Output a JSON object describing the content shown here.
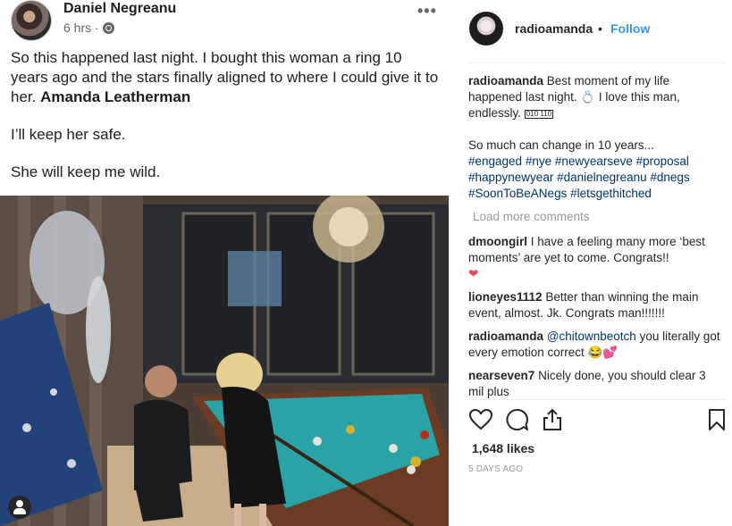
{
  "facebook": {
    "author": "Daniel Negreanu",
    "time": "6 hrs ·",
    "more": "•••",
    "paragraph1_text": "So this happened last night. I bought this woman a ring 10 years ago and the stars finally aligned to where I could give it to her.",
    "paragraph1_mention": "Amanda Leatherman",
    "paragraph2": "I’ll keep her safe.",
    "paragraph3": "She will keep me wild."
  },
  "instagram": {
    "handle": "radioamanda",
    "dot": "•",
    "follow": "Follow",
    "caption_user": "radioamanda",
    "caption_text": "Best moment of my life happened last night. 💍 I love this man, endlessly.",
    "caption_glyph": "010 110",
    "caption_line2": "So much can change in 10 years...",
    "hashtags": "#engaged #nye #newyearseve #proposal #happynewyear #danielnegreanu #dnegs #SoonToBeANegs #letsgethitched",
    "load_more": "Load more comments",
    "comments": [
      {
        "user": "dmoongirl",
        "text": "I have a feeling many more ‘best moments’ are yet to come. Congrats!!",
        "emoji": "❤"
      },
      {
        "user": "lioneyes1112",
        "text": "Better than winning the main event, almost. Jk. Congrats man!!!!!!!",
        "emoji": ""
      },
      {
        "user": "radioamanda",
        "mention": "@chitownbeotch",
        "text": "you literally got every emotion correct",
        "emoji": "😂💕"
      },
      {
        "user": "nearseven7",
        "text": "Nicely done, you should clear 3 mil plus",
        "emoji": ""
      }
    ],
    "likes": "1,648 likes",
    "ago": "5 DAYS AGO"
  },
  "icons": [
    "globe-icon",
    "more-options-icon",
    "heart-icon",
    "comment-icon",
    "share-icon",
    "bookmark-icon",
    "user-tag-icon"
  ],
  "colors": {
    "follow_blue": "#3897f0",
    "hashtag_blue": "#003569",
    "heart_red": "#ed4956",
    "muted_gray": "#999999"
  }
}
